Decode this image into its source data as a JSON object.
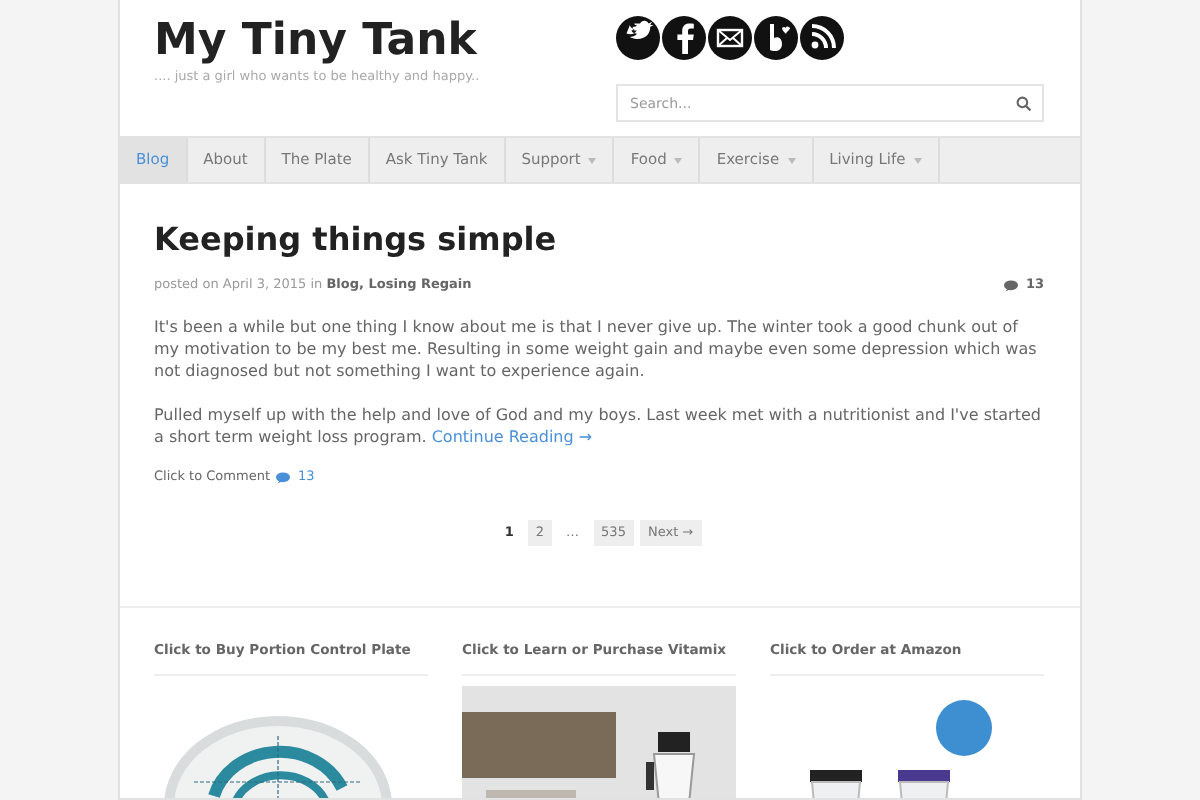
{
  "site": {
    "title": "My Tiny Tank",
    "tagline": ".... just a girl who wants to be healthy and happy.."
  },
  "search": {
    "placeholder": "Search..."
  },
  "nav": [
    {
      "label": "Blog",
      "selected": true,
      "dropdown": false
    },
    {
      "label": "About",
      "selected": false,
      "dropdown": false
    },
    {
      "label": "The Plate",
      "selected": false,
      "dropdown": false
    },
    {
      "label": "Ask Tiny Tank",
      "selected": false,
      "dropdown": false
    },
    {
      "label": "Support",
      "selected": false,
      "dropdown": true
    },
    {
      "label": "Food",
      "selected": false,
      "dropdown": true
    },
    {
      "label": "Exercise",
      "selected": false,
      "dropdown": true
    },
    {
      "label": "Living Life",
      "selected": false,
      "dropdown": true
    }
  ],
  "post": {
    "title": "Keeping things simple",
    "posted_on": "posted on",
    "date": "April 3, 2015",
    "in": "in",
    "categories": "Blog, Losing Regain",
    "comment_count": "13",
    "paragraphs": [
      "It's been a while but one thing I know about me is that I never give up. The winter took a good chunk out of my motivation to be my best me. Resulting in some weight gain and maybe even some depression which was not diagnosed but not something I want to experience again.",
      "Pulled myself up with the help and love of God and my boys. Last week met with a nutritionist and I've started a short term weight loss program."
    ],
    "continue": "Continue Reading →",
    "comment_label": "Click to Comment",
    "comment_link_count": "13"
  },
  "pagination": [
    {
      "label": "1",
      "kind": "page",
      "selected": true
    },
    {
      "label": "2",
      "kind": "page",
      "selected": false
    },
    {
      "label": "…",
      "kind": "gap"
    },
    {
      "label": "535",
      "kind": "page",
      "selected": false
    },
    {
      "label": "Next →",
      "kind": "page",
      "selected": false
    }
  ],
  "widgets": [
    {
      "title": "Click to Buy Portion Control Plate"
    },
    {
      "title": "Click to Learn or Purchase Vitamix"
    },
    {
      "title": "Click to Order at Amazon"
    }
  ]
}
